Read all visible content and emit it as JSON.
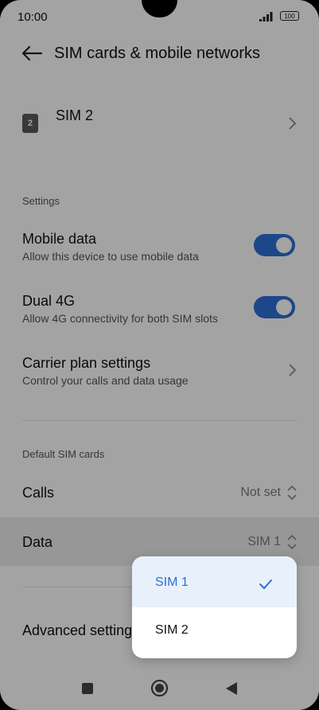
{
  "status_bar": {
    "time": "10:00",
    "battery": "100"
  },
  "header": {
    "title": "SIM cards & mobile networks"
  },
  "sim": {
    "badge": "2",
    "label": "SIM 2"
  },
  "settings": {
    "section_label": "Settings",
    "mobile_data": {
      "title": "Mobile data",
      "subtitle": "Allow this device to use mobile data",
      "enabled": true
    },
    "dual_4g": {
      "title": "Dual 4G",
      "subtitle": "Allow 4G connectivity for both SIM slots",
      "enabled": true
    },
    "carrier_plan": {
      "title": "Carrier plan settings",
      "subtitle": "Control your calls and data usage"
    }
  },
  "default_sim": {
    "section_label": "Default SIM cards",
    "calls": {
      "title": "Calls",
      "value": "Not set"
    },
    "data": {
      "title": "Data",
      "value": "SIM 1"
    }
  },
  "advanced": {
    "title": "Advanced settings"
  },
  "dropdown": {
    "options": [
      {
        "label": "SIM 1",
        "selected": true
      },
      {
        "label": "SIM 2",
        "selected": false
      }
    ]
  },
  "colors": {
    "accent": "#2c6fd6",
    "selected_bg": "#e8f1fb",
    "dim_overlay": "rgba(0,0,0,0.36)"
  }
}
